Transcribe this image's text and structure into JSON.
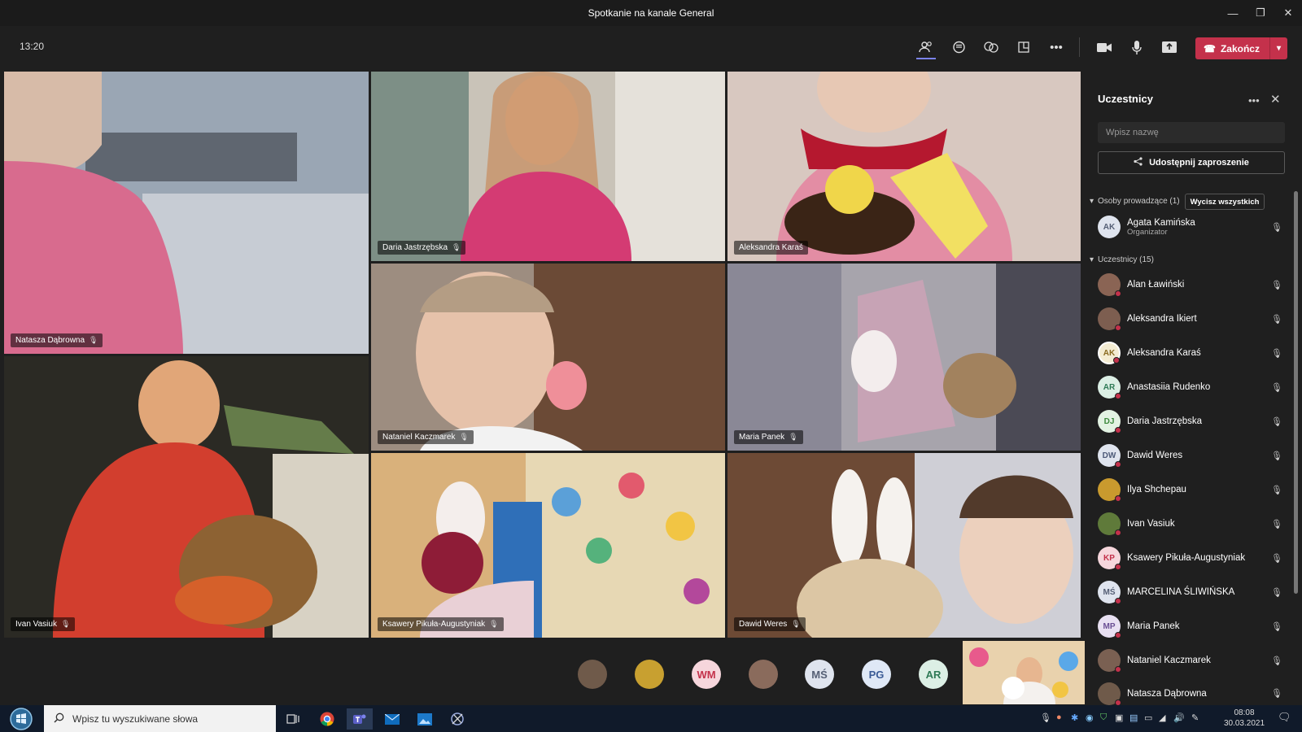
{
  "window": {
    "title": "Spotkanie na kanale General",
    "minimize": "—",
    "restore": "❐",
    "close": "✕"
  },
  "toolbar": {
    "time": "13:20",
    "end_button": "Zakończ"
  },
  "tiles": [
    {
      "name": "Natasza Dąbrowna"
    },
    {
      "name": "Daria Jastrzębska"
    },
    {
      "name": "Aleksandra Karaś"
    },
    {
      "name": "Nataniel Kaczmarek"
    },
    {
      "name": "Maria Panek"
    },
    {
      "name": "Ivan Vasiuk"
    },
    {
      "name": "Ksawery Pikuła-Augustyniak"
    },
    {
      "name": "Dawid Weres"
    }
  ],
  "strip_avatars": [
    "",
    "",
    "WM",
    "",
    "MŚ",
    "PG",
    "AR"
  ],
  "panel": {
    "title": "Uczestnicy",
    "search_placeholder": "Wpisz nazwę",
    "invite": "Udostępnij zaproszenie",
    "presenters_section": "Osoby prowadzące (1)",
    "mute_all": "Wycisz wszystkich",
    "organizer": {
      "name": "Agata Kamińska",
      "role": "Organizator",
      "initials": "AK"
    },
    "participants_section": "Uczestnicy (15)",
    "participants": [
      {
        "name": "Alan Ławiński",
        "initials": ""
      },
      {
        "name": "Aleksandra Ikiert",
        "initials": ""
      },
      {
        "name": "Aleksandra Karaś",
        "initials": "AK"
      },
      {
        "name": "Anastasiia Rudenko",
        "initials": "AR"
      },
      {
        "name": "Daria Jastrzębska",
        "initials": "DJ"
      },
      {
        "name": "Dawid Weres",
        "initials": "DW"
      },
      {
        "name": "Ilya Shchepau",
        "initials": ""
      },
      {
        "name": "Ivan Vasiuk",
        "initials": ""
      },
      {
        "name": "Ksawery Pikuła-Augustyniak",
        "initials": "KP"
      },
      {
        "name": "MARCELINA ŚLIWIŃSKA",
        "initials": "MŚ"
      },
      {
        "name": "Maria Panek",
        "initials": "MP"
      },
      {
        "name": "Nataniel Kaczmarek",
        "initials": ""
      },
      {
        "name": "Natasza Dąbrowna",
        "initials": ""
      }
    ]
  },
  "taskbar": {
    "search_placeholder": "Wpisz tu wyszukiwane słowa",
    "time": "08:08",
    "date": "30.03.2021"
  }
}
